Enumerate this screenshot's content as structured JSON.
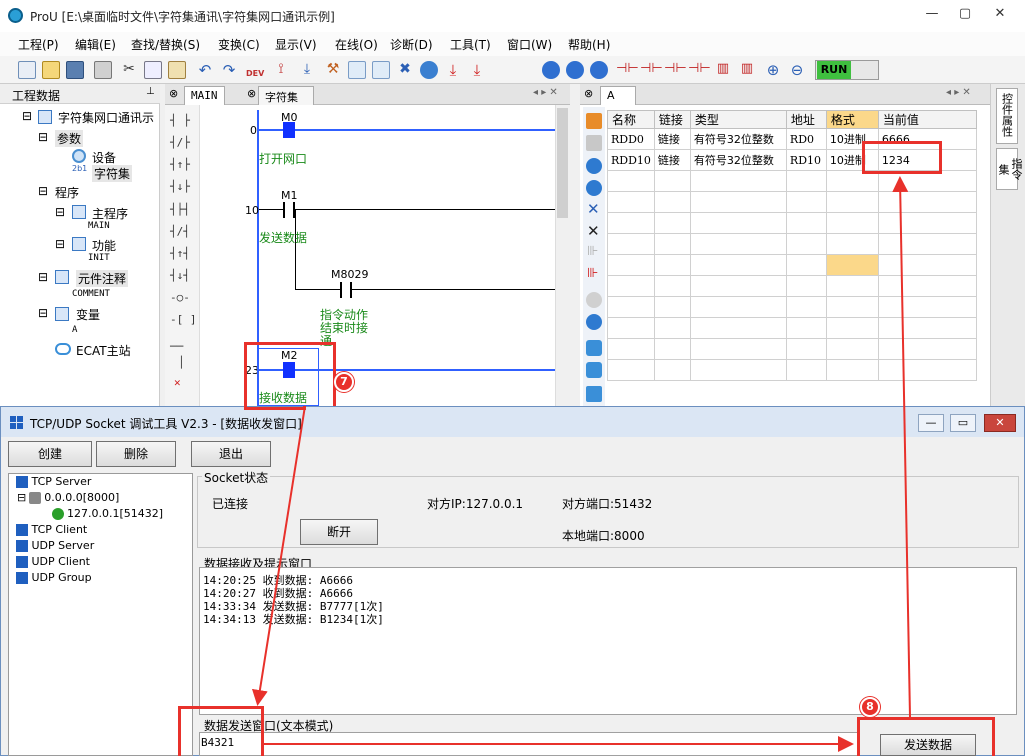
{
  "app": {
    "title": "ProU [E:\\桌面临时文件\\字符集通讯\\字符集网口通讯示例]"
  },
  "menu": [
    "工程(P)",
    "编辑(E)",
    "查找/替换(S)",
    "变换(C)",
    "显示(V)",
    "在线(O)",
    "诊断(D)",
    "工具(T)",
    "窗口(W)",
    "帮助(H)"
  ],
  "toolbar": {
    "run_label": "RUN"
  },
  "project_panel": {
    "header": "工程数据",
    "pin": "ㅁ",
    "root": "字符集网口通讯示",
    "params": "参数",
    "device": "设备",
    "charset": "字符集",
    "program": "程序",
    "main_program": "主程序",
    "main_sub": "MAIN",
    "function": "功能",
    "function_sub": "INIT",
    "component_comment": "元件注释",
    "comment_sub": "COMMENT",
    "variables": "变量",
    "variables_sub": "A",
    "ecat": "ECAT主站"
  },
  "ladder": {
    "tab_main": "MAIN",
    "tab_charset": "字符集",
    "rungs": [
      {
        "step": "0",
        "contact": "M0",
        "comment": "打开网口"
      },
      {
        "step": "10",
        "contact": "M1",
        "comment": "发送数据"
      },
      {
        "step": "",
        "contact": "M8029",
        "comment": "指令动作结束时接通"
      },
      {
        "step": "23",
        "contact": "M2",
        "comment": "接收数据"
      }
    ],
    "comment_m8029_lines": [
      "指令动作",
      "结束时接",
      "通"
    ]
  },
  "watch": {
    "tab": "A",
    "columns": [
      "名称",
      "链接",
      "类型",
      "地址",
      "格式",
      "当前值"
    ],
    "rows": [
      [
        "RDD0",
        "链接",
        "有符号32位整数",
        "RD0",
        "10进制",
        "6666"
      ],
      [
        "RDD10",
        "链接",
        "有符号32位整数",
        "RD10",
        "10进制",
        "1234"
      ]
    ]
  },
  "side_tabs": [
    "控件属性",
    "指令集"
  ],
  "dialog": {
    "title": "TCP/UDP Socket 调试工具 V2.3  - [数据收发窗口]",
    "buttons": {
      "create": "创建",
      "delete": "删除",
      "exit": "退出"
    },
    "tree": {
      "tcp_server": "TCP Server",
      "server_node": "0.0.0.0[8000]",
      "client_node": "127.0.0.1[51432]",
      "tcp_client": "TCP Client",
      "udp_server": "UDP Server",
      "udp_client": "UDP Client",
      "udp_group": "UDP Group"
    },
    "socket_group": "Socket状态",
    "status": "已连接",
    "remote_ip": "对方IP:127.0.0.1",
    "remote_port": "对方端口:51432",
    "local_port": "本地端口:8000",
    "disconnect": "断开",
    "recv_group": "数据接收及提示窗口",
    "log": [
      "14:20:25 收到数据: A6666",
      "14:20:27 收到数据: A6666",
      "14:33:34 发送数据: B7777[1次]",
      "14:34:13 发送数据: B1234[1次]"
    ],
    "send_group": "数据发送窗口(文本模式)",
    "send_value": "B4321",
    "send_button": "发送数据"
  },
  "annotations": {
    "badge7": "7",
    "badge8": "8"
  },
  "colors": {
    "annotation": "#e8312b",
    "rail": "#3060ff",
    "comment": "#1a8a1a",
    "run": "#3fbf3f"
  }
}
